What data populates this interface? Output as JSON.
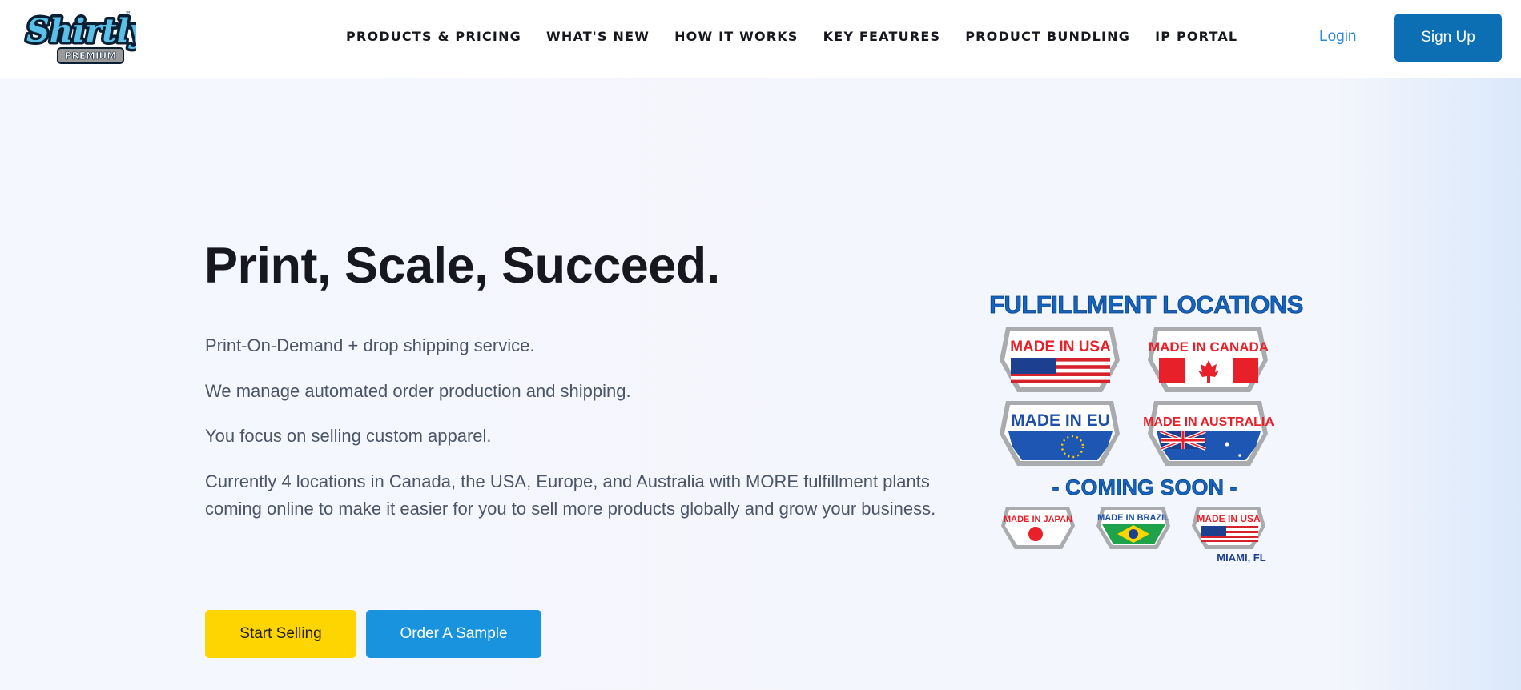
{
  "brand": {
    "logo_script": "Shirtly",
    "logo_badge": "PREMIUM",
    "trademark": "™"
  },
  "nav": {
    "items": [
      "PRODUCTS & PRICING",
      "WHAT'S NEW",
      "HOW IT WORKS",
      "KEY FEATURES",
      "PRODUCT BUNDLING",
      "IP PORTAL"
    ],
    "login_label": "Login",
    "signup_label": "Sign Up"
  },
  "hero": {
    "headline": "Print, Scale, Succeed.",
    "paragraphs": [
      "Print-On-Demand + drop shipping service.",
      "We manage automated order production and shipping.",
      "You focus on selling custom apparel.",
      "Currently 4 locations in Canada, the USA, Europe, and Australia with MORE fulfillment plants coming online to make it easier for you to sell more products globally and grow your business."
    ],
    "primary_cta": "Start Selling",
    "secondary_cta": "Order A Sample"
  },
  "fulfillment": {
    "title": "FULFILLMENT LOCATIONS",
    "current": [
      {
        "label": "MADE IN USA",
        "flag": "usa-flag-icon"
      },
      {
        "label": "MADE IN CANADA",
        "flag": "canada-flag-icon"
      },
      {
        "label": "MADE IN EU",
        "flag": "eu-flag-icon"
      },
      {
        "label": "MADE IN AUSTRALIA",
        "flag": "australia-flag-icon"
      }
    ],
    "coming_soon_label": "- COMING SOON -",
    "upcoming": [
      {
        "label": "MADE IN JAPAN",
        "flag": "japan-flag-icon"
      },
      {
        "label": "MADE IN BRAZIL",
        "flag": "brazil-flag-icon"
      },
      {
        "label": "MADE IN USA",
        "flag": "usa-flag-icon",
        "sublabel": "MIAMI, FL"
      }
    ]
  },
  "colors": {
    "accent_blue": "#0d6fb3",
    "link_blue": "#2a8ad6",
    "cta_yellow": "#ffd500",
    "cta_blue": "#1a93de",
    "heading_blue": "#1565c0",
    "badge_red": "#e8202a"
  }
}
